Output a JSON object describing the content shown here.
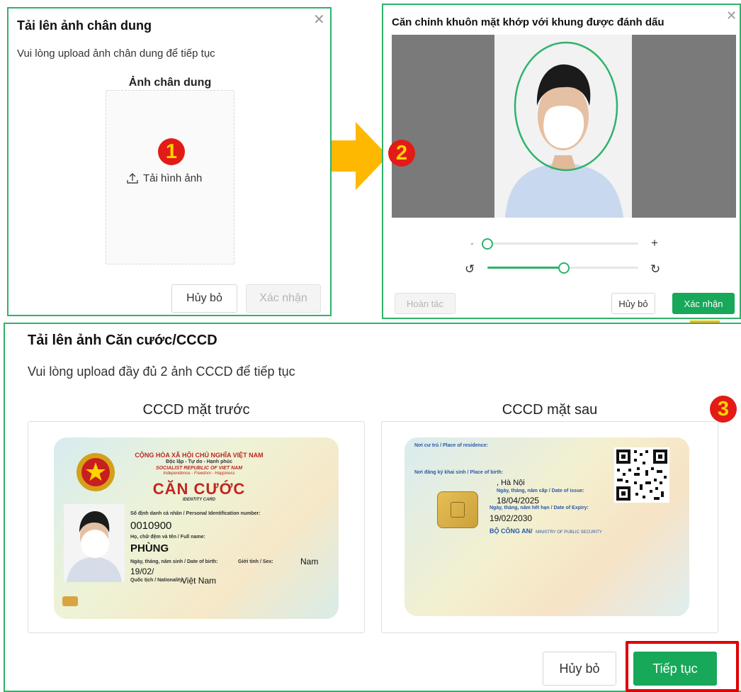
{
  "portrait_upload": {
    "title": "Tải lên ảnh chân dung",
    "subtitle": "Vui lòng upload ảnh chân dung để tiếp tục",
    "field_label": "Ảnh chân dung",
    "upload_label": "Tải hình ảnh",
    "cancel_label": "Hủy bỏ",
    "confirm_label": "Xác nhận",
    "step": "1"
  },
  "crop_dialog": {
    "title": "Căn chỉnh khuôn mặt khớp với khung được đánh dấu",
    "zoom_minus": "-",
    "zoom_plus": "+",
    "zoom_level": 0.0,
    "rotate_level": 0.5,
    "undo_label": "Hoàn tác",
    "cancel_label": "Hủy bỏ",
    "confirm_label": "Xác nhận",
    "step": "2"
  },
  "id_upload": {
    "title": "Tải lên ảnh Căn cước/CCCD",
    "subtitle": "Vui lòng upload đầy đủ 2 ảnh CCCD để tiếp tục",
    "front_label": "CCCD mặt trước",
    "back_label": "CCCD mặt sau",
    "cancel_label": "Hủy bỏ",
    "continue_label": "Tiếp tục",
    "step": "3"
  },
  "id_front": {
    "header1": "CỘNG HÒA XÃ HỘI CHỦ NGHĨA VIỆT NAM",
    "header2": "Độc lập - Tự do - Hạnh phúc",
    "header3": "SOCIALIST REPUBLIC OF VIET NAM",
    "header4": "Independence - Freedom - Happiness",
    "card_title": "CĂN CƯỚC",
    "card_title_en": "IDENTITY CARD",
    "id_label": "Số định danh cá nhân / Personal Identification number:",
    "id_number": "0010900",
    "name_label": "Họ, chữ đệm và tên / Full name:",
    "name_value": "PHÙNG",
    "dob_label": "Ngày, tháng, năm sinh / Date of birth:",
    "dob_value": "19/02/",
    "sex_label": "Giới tính / Sex:",
    "sex_value": "Nam",
    "nat_label": "Quốc tịch / Nationality:",
    "nat_value": "Việt Nam"
  },
  "id_back": {
    "residence_label": "Nơi cư trú / Place of residence:",
    "birth_reg_label": "Nơi đăng ký khai sinh / Place of birth:",
    "birth_reg_value": ", Hà Nội",
    "issue_label": "Ngày, tháng, năm cấp / Date of issue:",
    "issue_value": "18/04/2025",
    "expiry_label": "Ngày, tháng, năm hết hạn / Date of Expiry:",
    "expiry_value": "19/02/2030",
    "issuer": "BỘ CÔNG AN/",
    "issuer_en": "MINISTRY OF PUBLIC SECURITY"
  },
  "colors": {
    "green_border": "#2db36b",
    "primary_button": "#17a85a",
    "badge_red": "#e31b16",
    "badge_yellow": "#ffd400",
    "arrow_orange": "#ffb800",
    "highlight_red": "#e00000"
  }
}
